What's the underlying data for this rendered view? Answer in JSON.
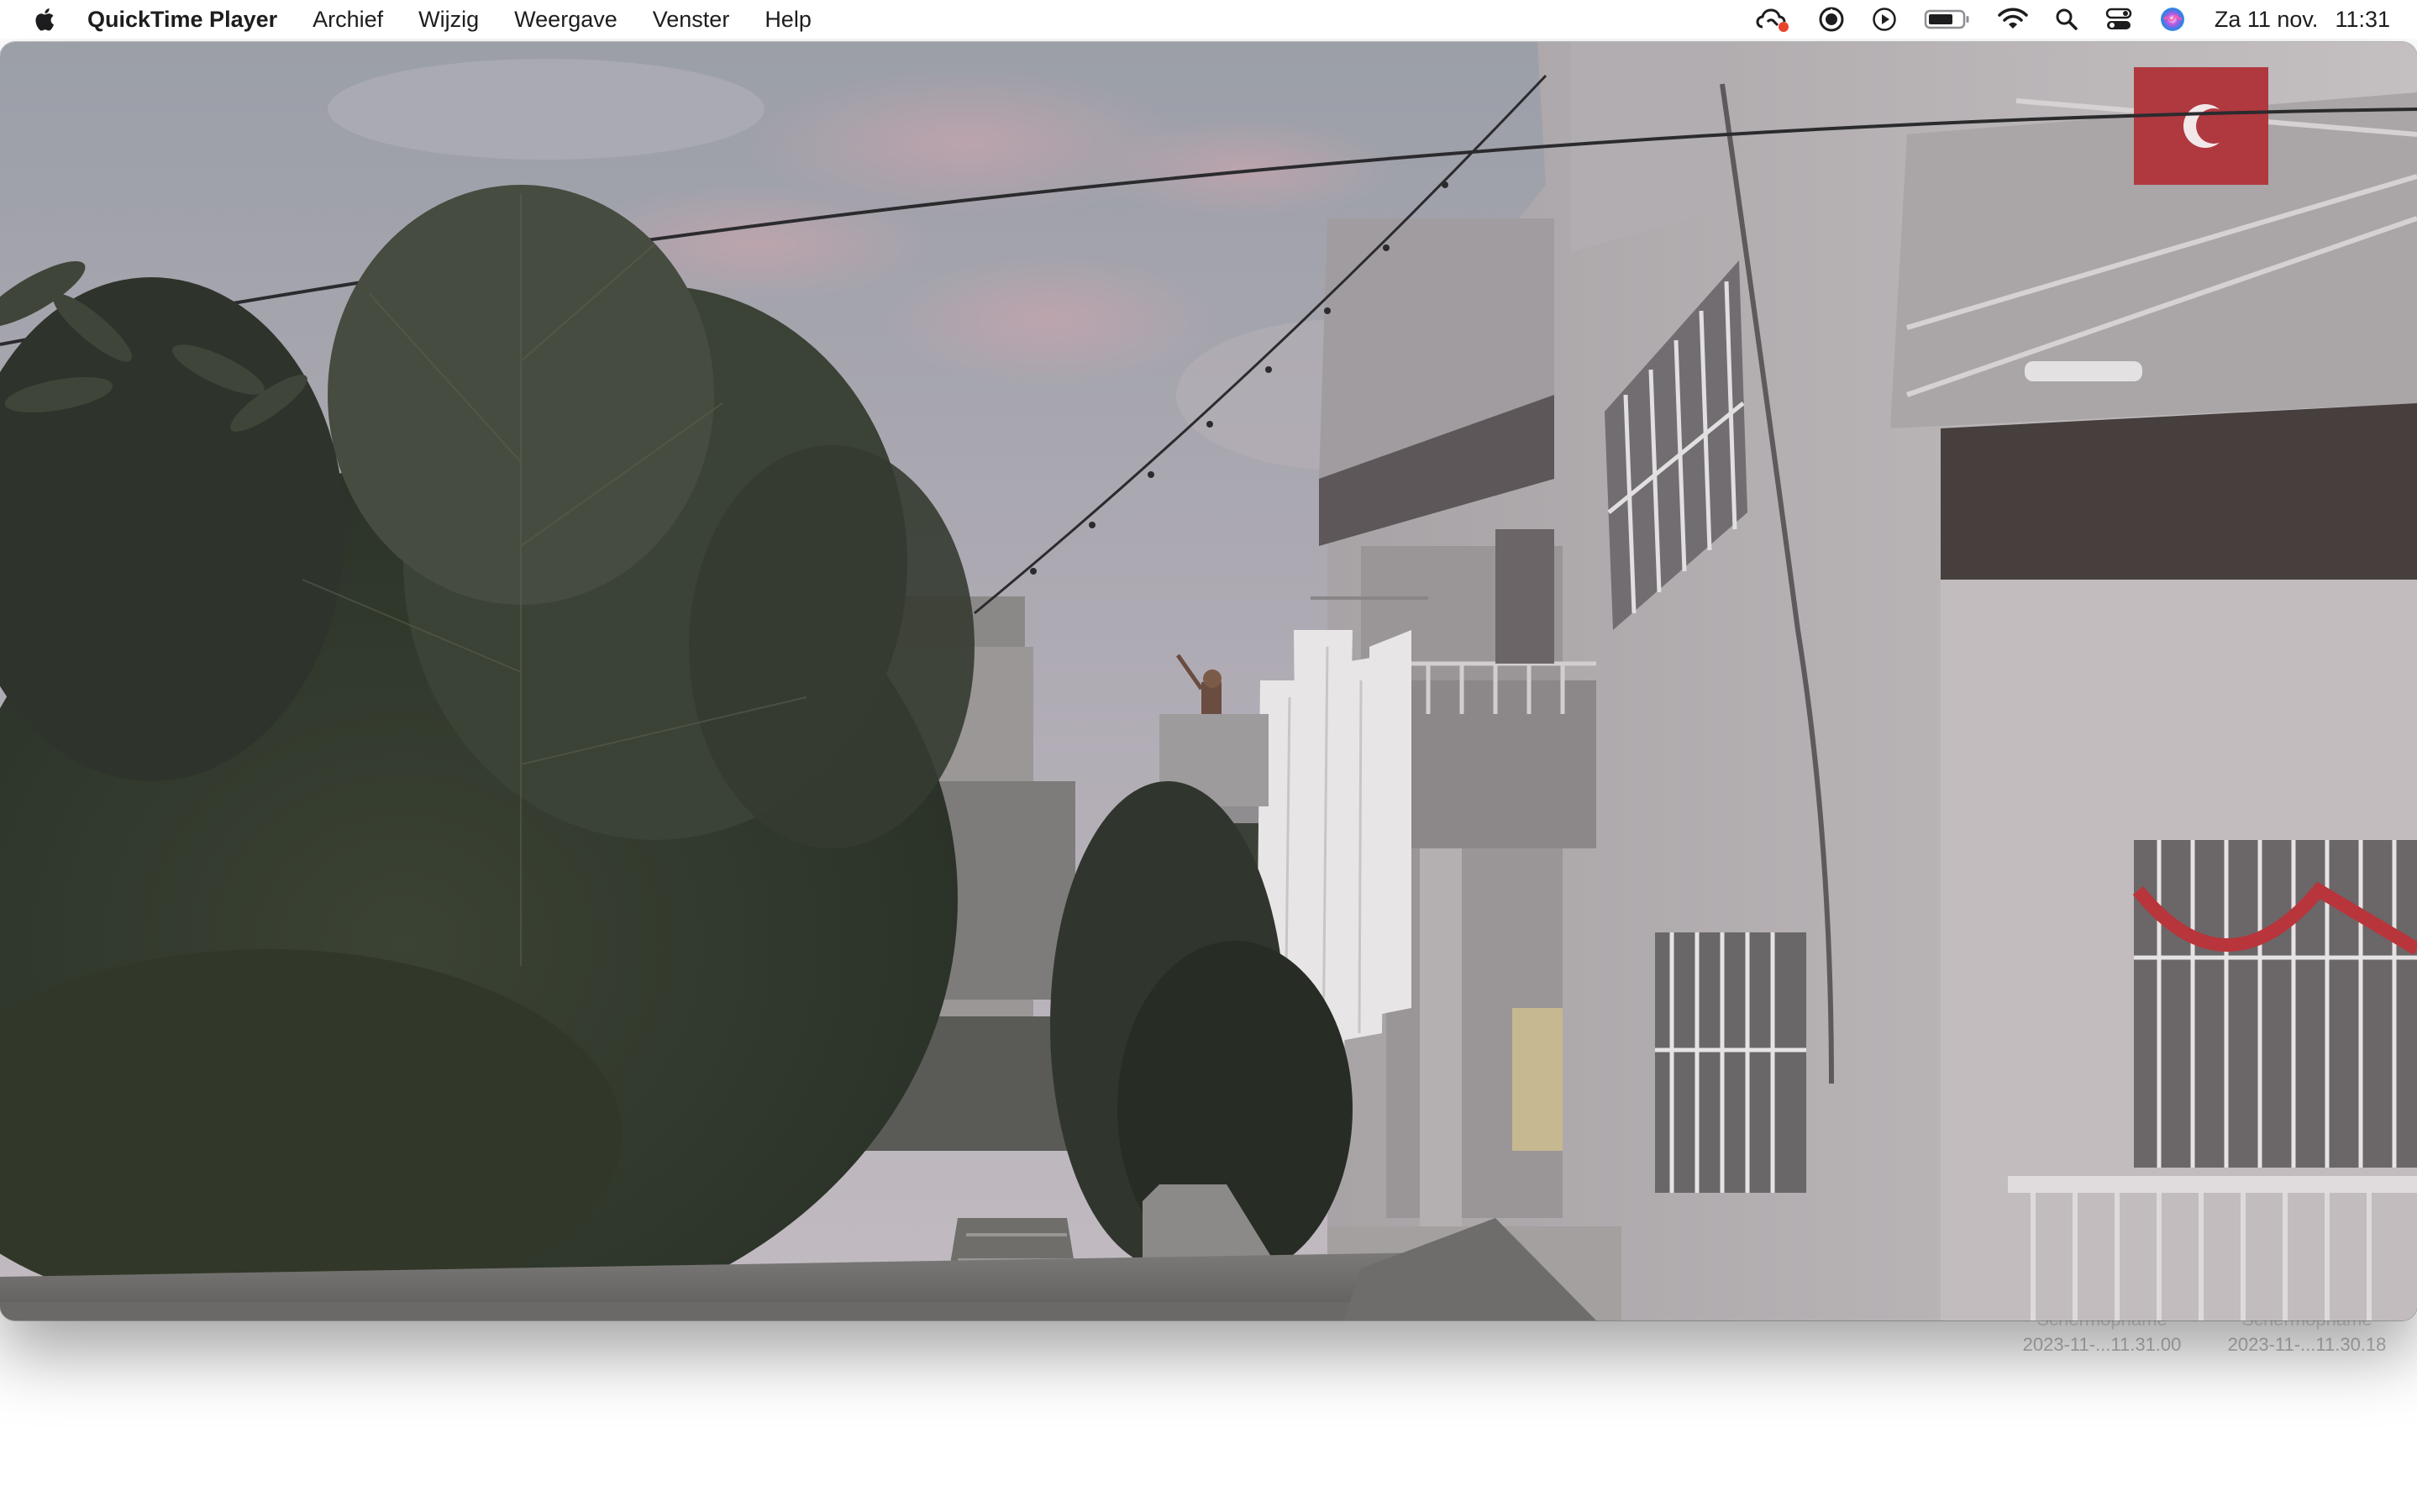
{
  "menubar": {
    "app_name": "QuickTime Player",
    "menus": [
      "Archief",
      "Wijzig",
      "Weergave",
      "Venster",
      "Help"
    ],
    "status_icons": [
      "creative-cloud-icon",
      "screen-record-icon",
      "play-circle-icon",
      "battery-icon",
      "wifi-icon",
      "spotlight-search-icon",
      "control-center-icon",
      "siri-icon"
    ],
    "clock": {
      "date": "Za 11 nov.",
      "time": "11:31"
    }
  },
  "window": {
    "app": "QuickTime Player",
    "content": "video frame of a residential street with pine tree, white apartment buildings, laundry hanging on a balcony, overcast dusk sky"
  },
  "desktop_files": [
    {
      "name": "Schermopname",
      "date": "2023-11-...11.31.00"
    },
    {
      "name": "Schermopname",
      "date": "2023-11-...11.30.18"
    }
  ],
  "colors": {
    "menubar_bg": "#ffffff",
    "record_badge": "#e8452c",
    "desktop_bg": "#ffffff"
  }
}
